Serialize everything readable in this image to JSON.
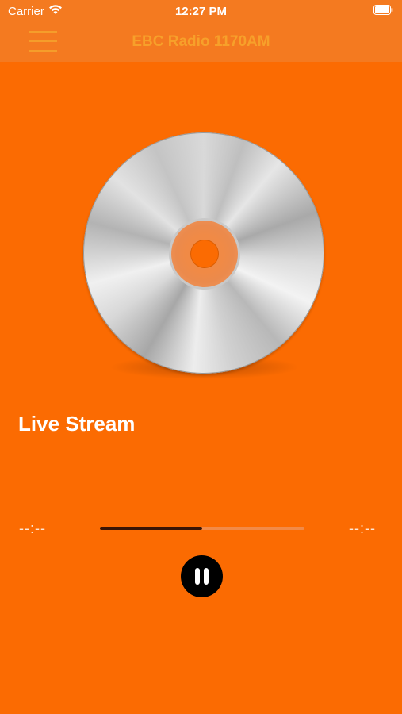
{
  "status_bar": {
    "carrier": "Carrier",
    "time": "12:27 PM",
    "icons": [
      "wifi-icon",
      "battery-icon"
    ]
  },
  "nav": {
    "title": "EBC Radio 1170AM",
    "menu_icon": "hamburger-menu-icon"
  },
  "player": {
    "artwork_icon": "cd-disc-icon",
    "track_title": "Live Stream",
    "elapsed": "--:--",
    "remaining": "--:--",
    "progress": 0.5,
    "control_icon": "pause-icon"
  },
  "colors": {
    "background": "#FB6B02",
    "bar": "#F47A20",
    "title": "#F7A02A"
  }
}
